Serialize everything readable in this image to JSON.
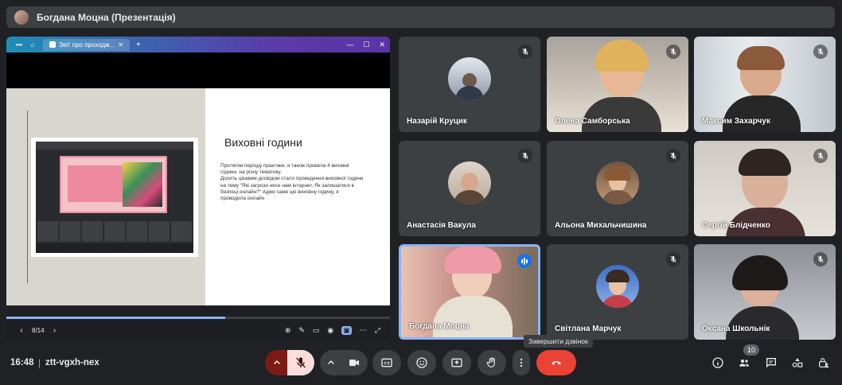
{
  "topbar": {
    "presenter_title": "Богдана Моцна (Презентація)"
  },
  "browser": {
    "tab_title": "Звіт про проходж...",
    "new_tab_symbol": "+",
    "menu_symbol": "•••"
  },
  "slide": {
    "heading": "Виховні години",
    "body": "Протягом періоду практики, я також провела 4 виховні години, на різну тематику.\n Досить цікавим досвідом стало проведення виховної години на тему \"Які загрози несе нам інтернет. Як залишатися в безпеці онлайн?\" Адже саме цю виховну годину, я проводила онлайн",
    "page_counter": "8/14",
    "progress": 0.57
  },
  "participants": [
    {
      "name": "Назарій Круцик",
      "muted": true
    },
    {
      "name": "Олена Самборська",
      "muted": true
    },
    {
      "name": "Максим Захарчук",
      "muted": true
    },
    {
      "name": "Анастасія Вакула",
      "muted": true
    },
    {
      "name": "Альона Михальчишина",
      "muted": true
    },
    {
      "name": "Сергій Блідченко",
      "muted": true
    },
    {
      "name": "Богдана Моцна",
      "muted": false,
      "speaking": true
    },
    {
      "name": "Світлана Марчук",
      "muted": true
    },
    {
      "name": "Оксана Школьнік",
      "muted": true
    }
  ],
  "tooltip": "Завершити дзвінок",
  "bottom": {
    "time": "16:48",
    "separator": "|",
    "meeting_code": "ztt-vgxh-nex",
    "people_count": "10"
  },
  "colors": {
    "end_call": "#ea4335",
    "mic_off_bg": "#f9dedc",
    "active_blue": "#8ab4f8"
  }
}
